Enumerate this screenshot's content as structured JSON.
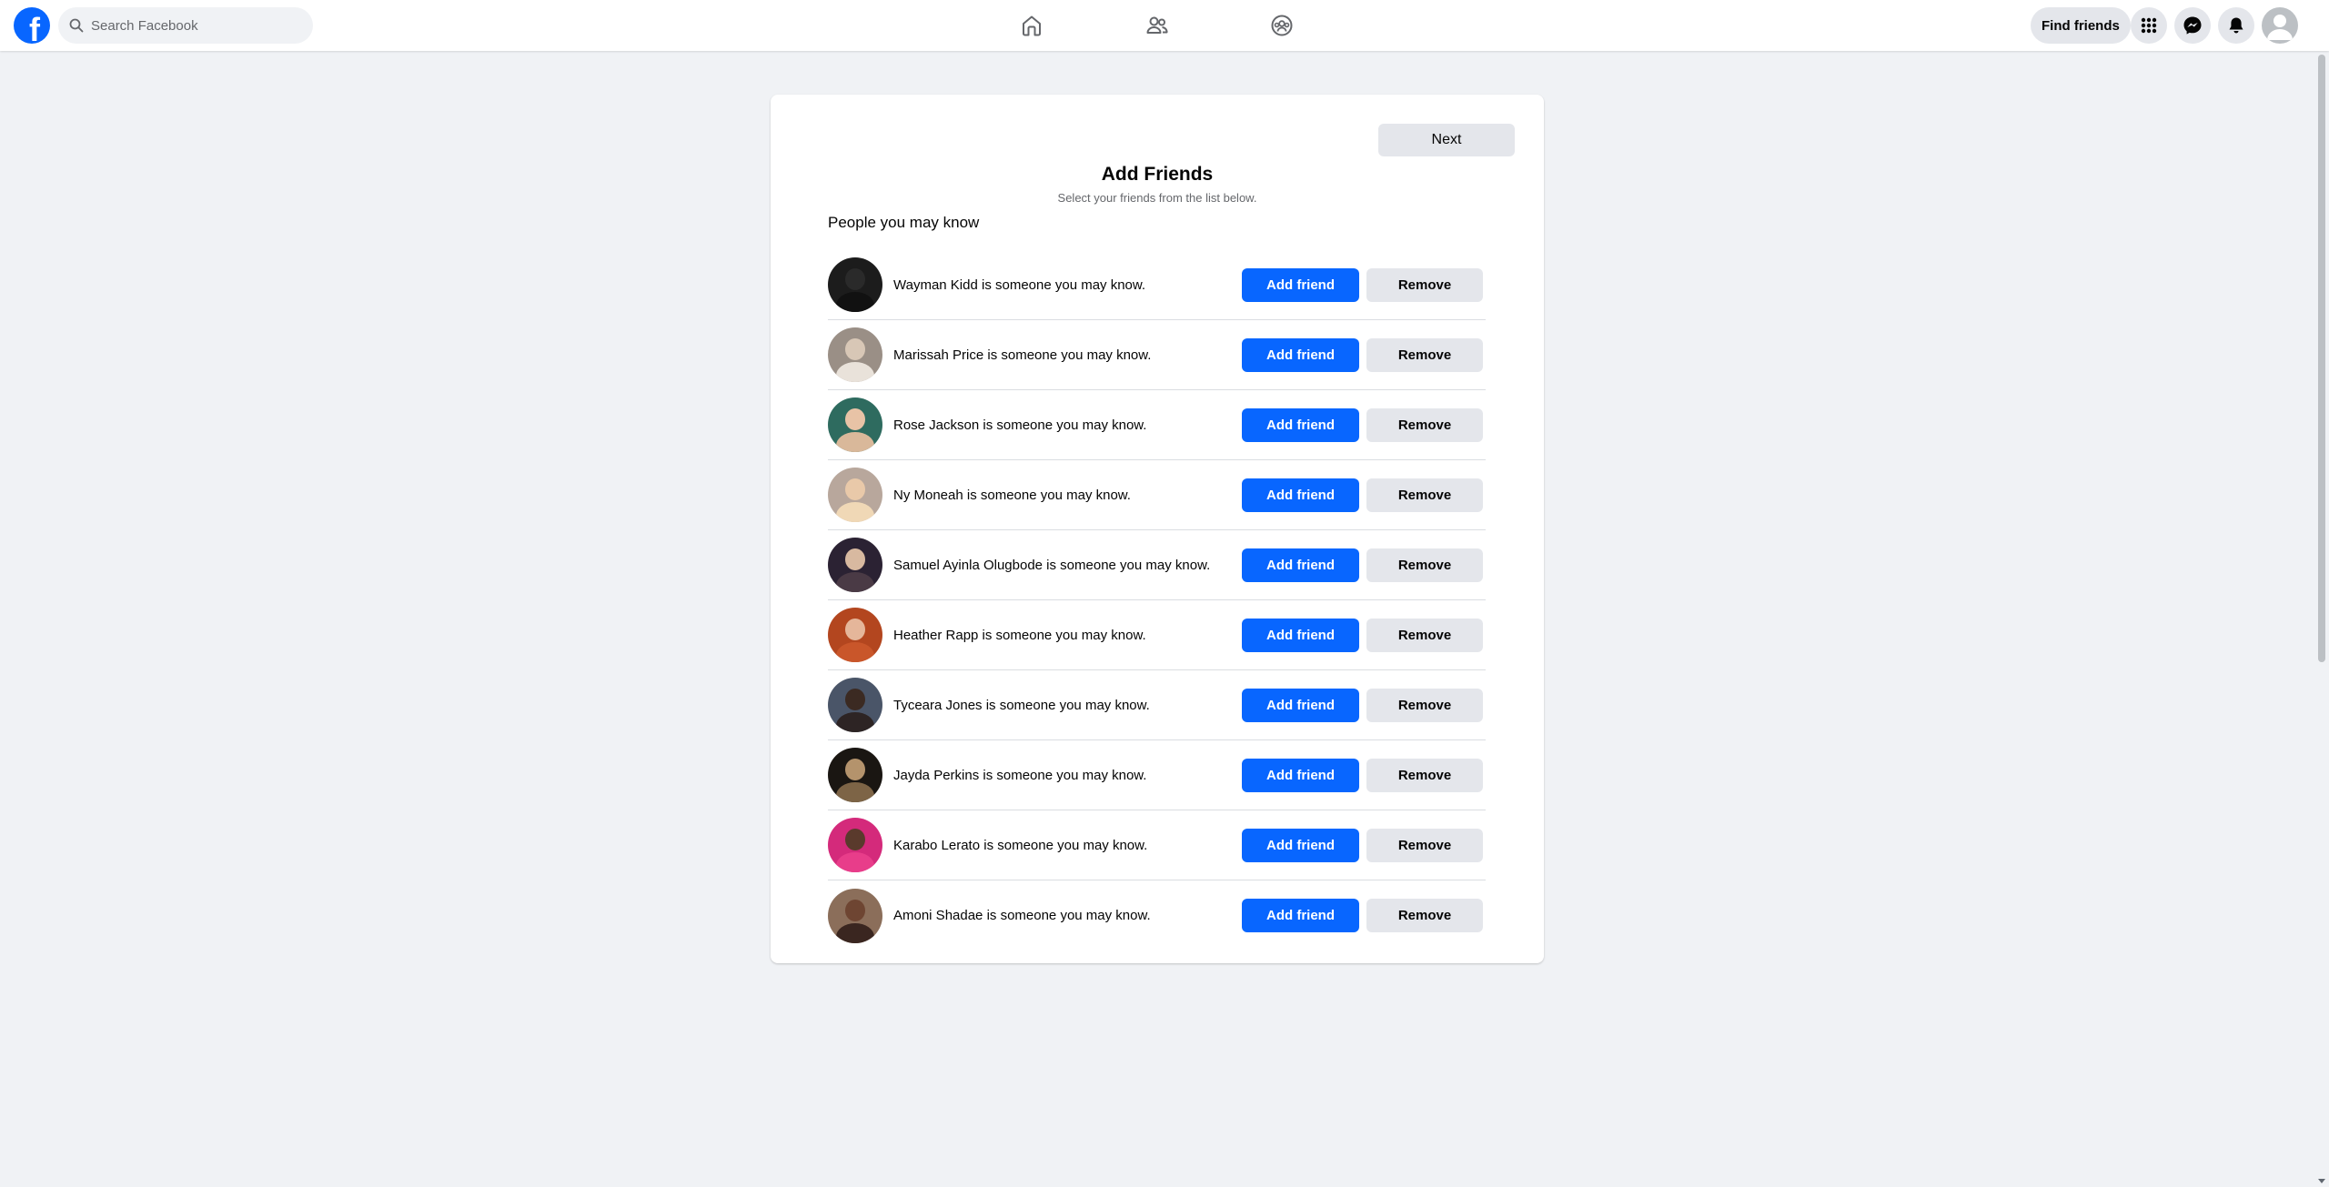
{
  "topbar": {
    "logo_letter": "f",
    "search": {
      "placeholder": "Search Facebook",
      "value": ""
    },
    "nav": {
      "home_icon": "home-icon",
      "friends_icon": "friends-icon",
      "groups_icon": "groups-icon"
    },
    "find_friends_label": "Find friends",
    "right_icons": [
      "menu-grid-icon",
      "messenger-icon",
      "notifications-icon",
      "account-avatar-icon"
    ]
  },
  "card": {
    "next_label": "Next",
    "title": "Add Friends",
    "subtitle": "Select your friends from the list below.",
    "section_title": "People you may know",
    "add_label": "Add friend",
    "remove_label": "Remove",
    "people": [
      {
        "text": "Wayman Kidd is someone you may know.",
        "avatar_bg": "#1c1c1c",
        "head": "#2a2a2a",
        "body": "#111111"
      },
      {
        "text": "Marissah Price is someone you may know.",
        "avatar_bg": "#9a8f86",
        "head": "#d8c7b6",
        "body": "#e9e2da"
      },
      {
        "text": "Rose Jackson is someone you may know.",
        "avatar_bg": "#2e6b5f",
        "head": "#e8c3a6",
        "body": "#d9b89a"
      },
      {
        "text": "Ny Moneah is someone you may know.",
        "avatar_bg": "#b8a79c",
        "head": "#e9c9a9",
        "body": "#f0d8b6"
      },
      {
        "text": "Samuel Ayinla Olugbode is someone you may know.",
        "avatar_bg": "#2b2233",
        "head": "#d8b9a0",
        "body": "#4a3a45"
      },
      {
        "text": "Heather Rapp is someone you may know.",
        "avatar_bg": "#b3461f",
        "head": "#e5b69a",
        "body": "#c9562a"
      },
      {
        "text": "Tyceara Jones is someone you may know.",
        "avatar_bg": "#4a5568",
        "head": "#3b2a22",
        "body": "#2d2424"
      },
      {
        "text": "Jayda Perkins is someone you may know.",
        "avatar_bg": "#1a1612",
        "head": "#b4936c",
        "body": "#7d6446"
      },
      {
        "text": "Karabo Lerato is someone you may know.",
        "avatar_bg": "#d42a7b",
        "head": "#5a3a2c",
        "body": "#e83d8a"
      },
      {
        "text": "Amoni Shadae is someone you may know.",
        "avatar_bg": "#8b6e5a",
        "head": "#6e4532",
        "body": "#3a2620"
      }
    ]
  },
  "colors": {
    "brand": "#0866ff",
    "page_bg": "#f0f2f5",
    "secondary_button": "#e4e6eb"
  }
}
